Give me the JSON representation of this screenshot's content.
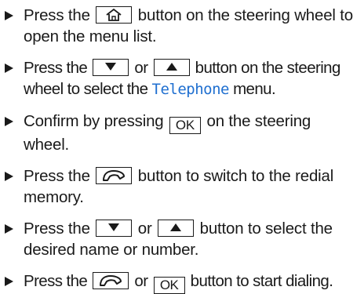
{
  "steps": [
    {
      "before": "Press the",
      "after": "button on the steering wheel to open the menu list."
    },
    {
      "before": "Press the",
      "or": "or",
      "after": "button on the steering wheel to select the",
      "menu_name": "Telephone",
      "menu_suffix": "menu."
    },
    {
      "before": "Confirm by pressing",
      "key": "OK",
      "after": "on the steering wheel."
    },
    {
      "before": "Press the",
      "after": "button to switch to the redial memory."
    },
    {
      "before": "Press the",
      "or": "or",
      "after": "button to select the desired name or number."
    },
    {
      "before": "Press the",
      "or": "or",
      "key": "OK",
      "after": "button to start dialing."
    }
  ],
  "icons": {
    "home": "home-icon",
    "down": "down-arrow-icon",
    "up": "up-arrow-icon",
    "phone": "phone-handset-icon"
  }
}
